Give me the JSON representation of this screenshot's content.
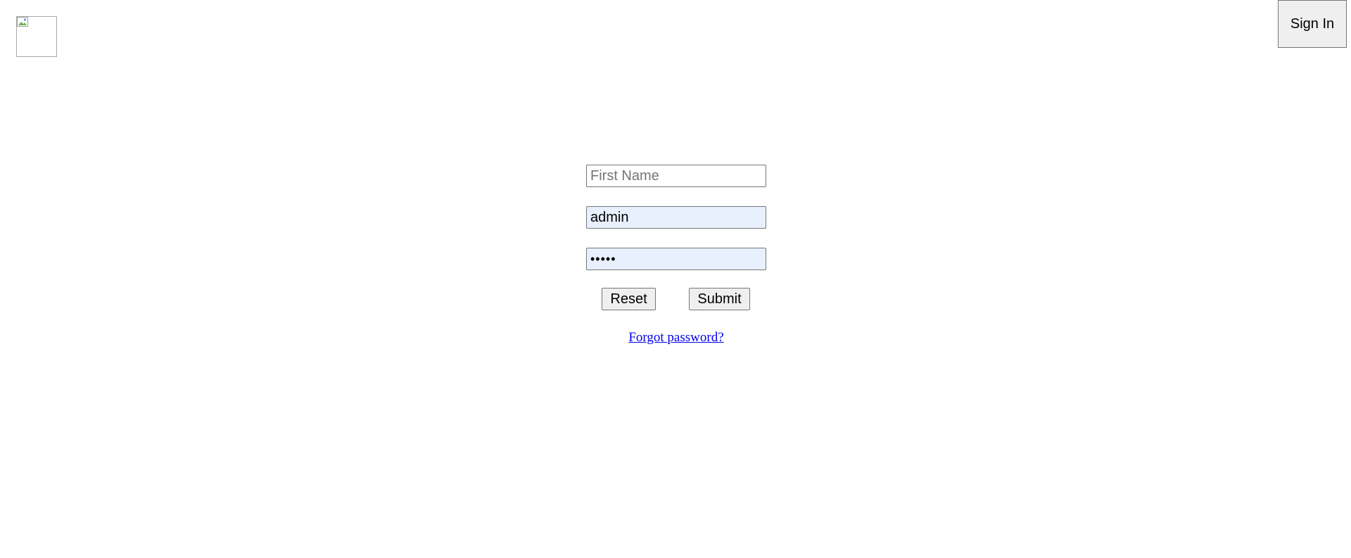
{
  "header": {
    "logo_icon": "broken-image-icon",
    "signin_label": "Sign In"
  },
  "form": {
    "first_name": {
      "value": "",
      "placeholder": "First Name"
    },
    "username": {
      "value": "admin",
      "placeholder": ""
    },
    "password": {
      "value": "•••••",
      "placeholder": ""
    },
    "reset_label": "Reset",
    "submit_label": "Submit",
    "forgot_label": "Forgot password?"
  },
  "colors": {
    "autofill_bg": "#e8f0fe",
    "link": "#0000ee",
    "button_bg": "#efefef"
  }
}
